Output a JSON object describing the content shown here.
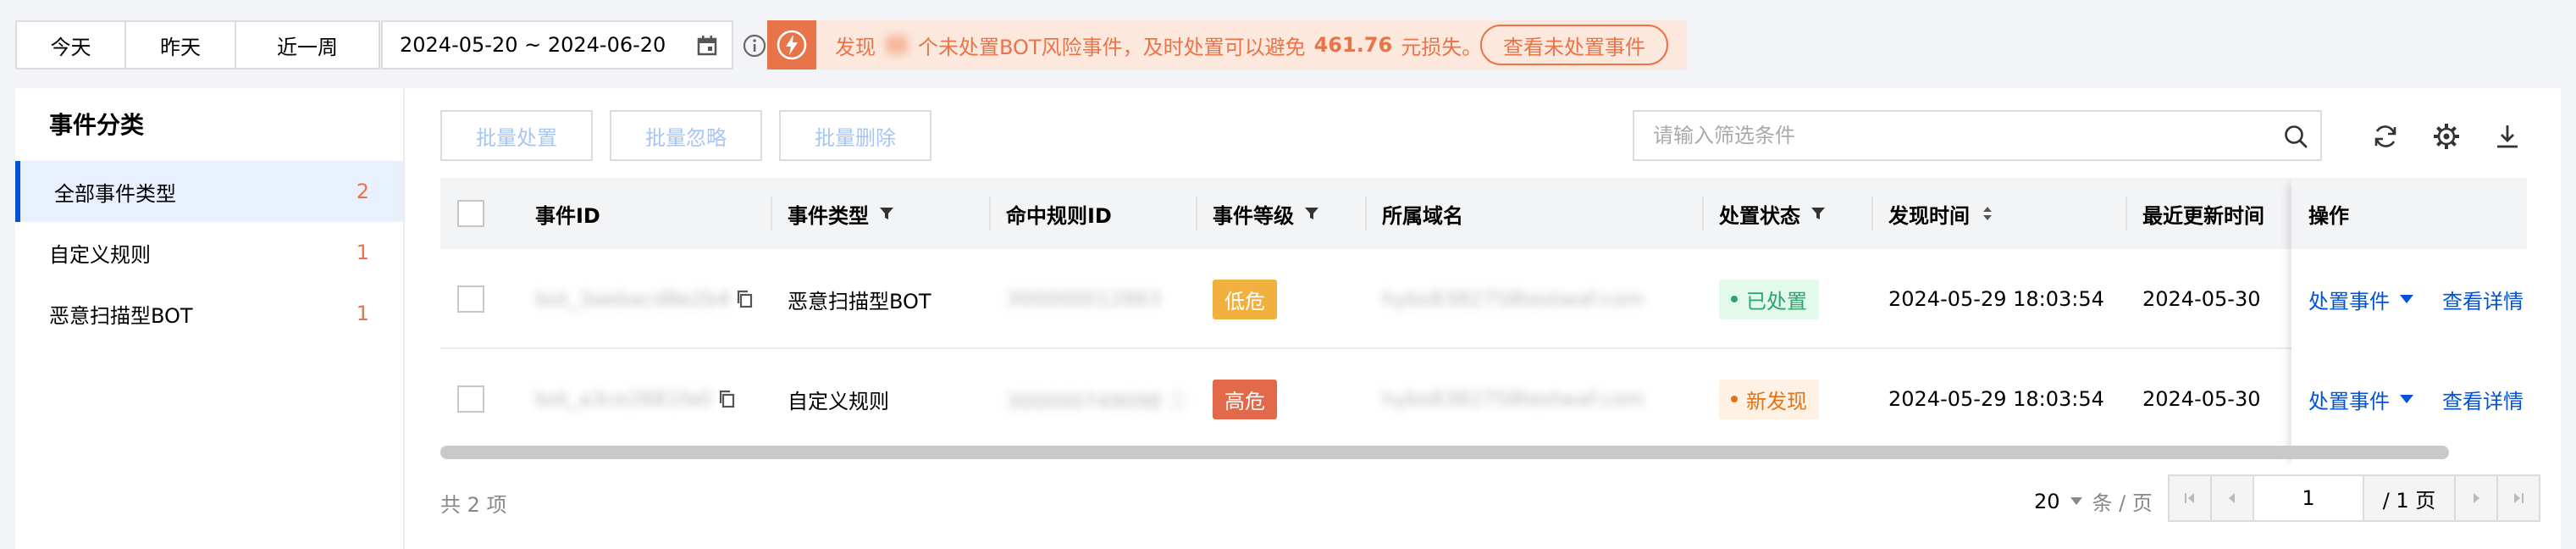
{
  "quick_range": [
    "今天",
    "昨天",
    "近一周"
  ],
  "date_range": "2024-05-20 ~ 2024-06-20",
  "alert": {
    "prefix": "发现",
    "suffix": "个未处置BOT风险事件，及时处置可以避免",
    "amount": "461.76",
    "unit": "元损失。",
    "button": "查看未处置事件"
  },
  "sidebar": {
    "title": "事件分类",
    "items": [
      {
        "label": "全部事件类型",
        "count": "2"
      },
      {
        "label": "自定义规则",
        "count": "1"
      },
      {
        "label": "恶意扫描型BOT",
        "count": "1"
      }
    ]
  },
  "toolbar": {
    "batch_handle": "批量处置",
    "batch_ignore": "批量忽略",
    "batch_delete": "批量删除",
    "search_placeholder": "请输入筛选条件"
  },
  "table": {
    "headers": {
      "event_id": "事件ID",
      "event_type": "事件类型",
      "rule_id": "命中规则ID",
      "level": "事件等级",
      "domain": "所属域名",
      "status": "处置状态",
      "found_time": "发现时间",
      "updated_time": "最近更新时间",
      "action": "操作"
    },
    "rows": [
      {
        "event_type": "恶意扫描型BOT",
        "level": "低危",
        "status": "已处置",
        "found_time": "2024-05-29 18:03:54",
        "updated_time": "2024-05-30",
        "action_handle": "处置事件",
        "action_detail": "查看详情"
      },
      {
        "event_type": "自定义规则",
        "level": "高危",
        "status": "新发现",
        "found_time": "2024-05-29 18:03:54",
        "updated_time": "2024-05-30",
        "action_handle": "处置事件",
        "action_detail": "查看详情"
      }
    ]
  },
  "footer": {
    "total": "共 2 项",
    "page_size": "20",
    "page_size_unit": "条 / 页",
    "current_page": "1",
    "page_total": "/ 1 页"
  },
  "colors": {
    "primary": "#0052d9",
    "warning": "#e8744a",
    "low_level": "#f2b13f",
    "high_level": "#e2694a",
    "done_status": "#2ba471",
    "new_status": "#e37318"
  }
}
